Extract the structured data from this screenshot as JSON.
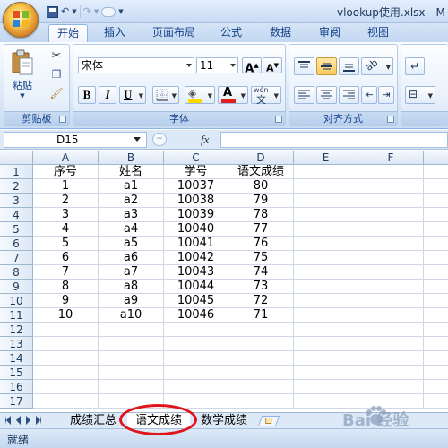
{
  "window": {
    "title": "vlookup使用.xlsx - M"
  },
  "ribbon_tabs": [
    "开始",
    "插入",
    "页面布局",
    "公式",
    "数据",
    "审阅",
    "视图"
  ],
  "clipboard": {
    "paste_label": "粘贴",
    "group_label": "剪贴板"
  },
  "font": {
    "name": "宋体",
    "size": "11",
    "bold": "B",
    "italic": "I",
    "underline": "U",
    "grow": "A",
    "shrink": "A",
    "font_color_letter": "A",
    "phonetic": "wén",
    "group_label": "字体",
    "font_color": "#e21f1f",
    "fill_color": "#ffd900"
  },
  "alignment": {
    "group_label": "对齐方式"
  },
  "formula_bar": {
    "name_box": "D15",
    "fx": "fx",
    "formula": ""
  },
  "columns": [
    "A",
    "B",
    "C",
    "D",
    "E",
    "F"
  ],
  "row_numbers": [
    "1",
    "2",
    "3",
    "4",
    "5",
    "6",
    "7",
    "8",
    "9",
    "10",
    "11",
    "12",
    "13",
    "14",
    "15",
    "16",
    "17"
  ],
  "table": {
    "headers": [
      "序号",
      "姓名",
      "学号",
      "语文成绩"
    ],
    "rows": [
      [
        "1",
        "a1",
        "10037",
        "80"
      ],
      [
        "2",
        "a2",
        "10038",
        "79"
      ],
      [
        "3",
        "a3",
        "10039",
        "78"
      ],
      [
        "4",
        "a4",
        "10040",
        "77"
      ],
      [
        "5",
        "a5",
        "10041",
        "76"
      ],
      [
        "6",
        "a6",
        "10042",
        "75"
      ],
      [
        "7",
        "a7",
        "10043",
        "74"
      ],
      [
        "8",
        "a8",
        "10044",
        "73"
      ],
      [
        "9",
        "a9",
        "10045",
        "72"
      ],
      [
        "10",
        "a10",
        "10046",
        "71"
      ]
    ]
  },
  "sheets": [
    {
      "name": "成绩汇总",
      "active": false
    },
    {
      "name": "语文成绩",
      "active": true
    },
    {
      "name": "数学成绩",
      "active": false
    }
  ],
  "status": {
    "text": "就绪"
  },
  "watermark": {
    "text": "Bai 经验"
  },
  "colors": {
    "annotation_red": "#e0151b",
    "ribbon_blue": "#15428b"
  }
}
